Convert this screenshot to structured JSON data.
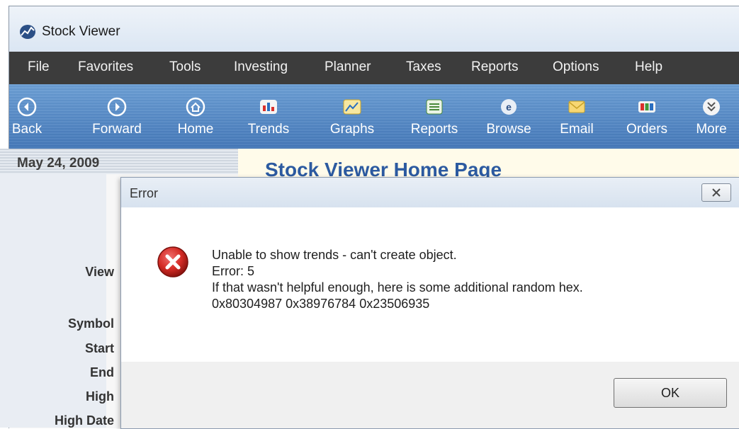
{
  "window": {
    "title": "Stock Viewer",
    "icon": "app-logo-icon"
  },
  "menu": [
    "File",
    "Favorites",
    "Tools",
    "Investing",
    "Planner",
    "Taxes",
    "Reports",
    "Options",
    "Help"
  ],
  "toolbar": [
    {
      "label": "Back",
      "icon": "back-arrow-icon"
    },
    {
      "label": "Forward",
      "icon": "forward-arrow-icon"
    },
    {
      "label": "Home",
      "icon": "home-icon"
    },
    {
      "label": "Trends",
      "icon": "trends-chart-icon"
    },
    {
      "label": "Graphs",
      "icon": "graphs-icon"
    },
    {
      "label": "Reports",
      "icon": "reports-icon"
    },
    {
      "label": "Browse",
      "icon": "browse-globe-icon"
    },
    {
      "label": "Email",
      "icon": "email-envelope-icon"
    },
    {
      "label": "Orders",
      "icon": "orders-icon"
    },
    {
      "label": "More",
      "icon": "more-chevrons-icon"
    }
  ],
  "sidebar": {
    "date": "May 24, 2009",
    "labels": [
      "View",
      "Symbol",
      "Start",
      "End",
      "High",
      "High Date"
    ]
  },
  "main": {
    "heading": "Stock Viewer Home Page"
  },
  "dialog": {
    "title": "Error",
    "lines": [
      "Unable to show trends - can't create object.",
      "Error: 5",
      "If that wasn't helpful enough, here is some additional random hex.",
      "0x80304987 0x38976784 0x23506935"
    ],
    "ok_label": "OK",
    "icon": "error-x-icon"
  },
  "colors": {
    "menubar": "#3c3c3c",
    "toolbar": "#4a7fc0",
    "error_red": "#c8201c",
    "heading_blue": "#2c5aa0"
  }
}
